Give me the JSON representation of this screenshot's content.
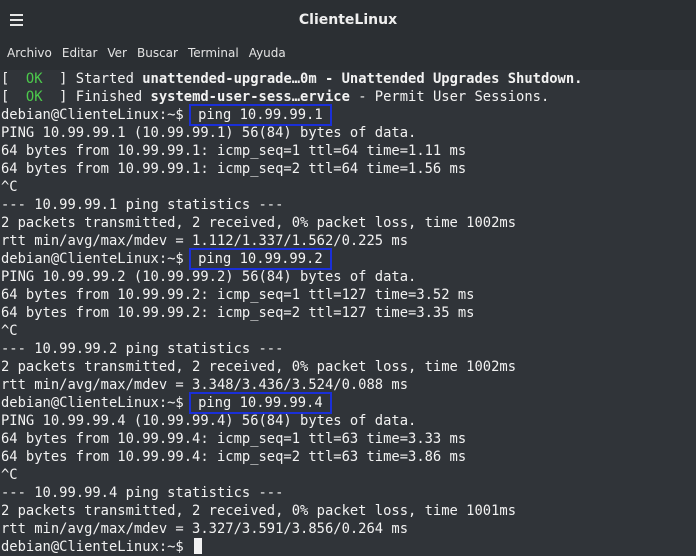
{
  "window": {
    "title": "ClienteLinux"
  },
  "menu": [
    "Archivo",
    "Editar",
    "Ver",
    "Buscar",
    "Terminal",
    "Ayuda"
  ],
  "prompt": "debian@ClienteLinux:~$ ",
  "lines": [
    {
      "type": "status",
      "pre": "[  ",
      "ok": "OK",
      "mid": "  ] Started ",
      "unit": "unattended-upgrade…0m - Unattended Upgrades Shutdown.",
      "rest": ""
    },
    {
      "type": "status",
      "pre": "[  ",
      "ok": "OK",
      "mid": "  ] Finished ",
      "unit": "systemd-user-sess…ervice",
      "rest": " - Permit User Sessions."
    },
    {
      "type": "prompt",
      "command": "ping 10.99.99.1"
    },
    {
      "type": "text",
      "text": "PING 10.99.99.1 (10.99.99.1) 56(84) bytes of data."
    },
    {
      "type": "text",
      "text": "64 bytes from 10.99.99.1: icmp_seq=1 ttl=64 time=1.11 ms"
    },
    {
      "type": "text",
      "text": "64 bytes from 10.99.99.1: icmp_seq=2 ttl=64 time=1.56 ms"
    },
    {
      "type": "text",
      "text": "^C"
    },
    {
      "type": "text",
      "text": "--- 10.99.99.1 ping statistics ---"
    },
    {
      "type": "text",
      "text": "2 packets transmitted, 2 received, 0% packet loss, time 1002ms"
    },
    {
      "type": "text",
      "text": "rtt min/avg/max/mdev = 1.112/1.337/1.562/0.225 ms"
    },
    {
      "type": "prompt",
      "command": "ping 10.99.99.2"
    },
    {
      "type": "text",
      "text": "PING 10.99.99.2 (10.99.99.2) 56(84) bytes of data."
    },
    {
      "type": "text",
      "text": "64 bytes from 10.99.99.2: icmp_seq=1 ttl=127 time=3.52 ms"
    },
    {
      "type": "text",
      "text": "64 bytes from 10.99.99.2: icmp_seq=2 ttl=127 time=3.35 ms"
    },
    {
      "type": "text",
      "text": "^C"
    },
    {
      "type": "text",
      "text": "--- 10.99.99.2 ping statistics ---"
    },
    {
      "type": "text",
      "text": "2 packets transmitted, 2 received, 0% packet loss, time 1002ms"
    },
    {
      "type": "text",
      "text": "rtt min/avg/max/mdev = 3.348/3.436/3.524/0.088 ms"
    },
    {
      "type": "prompt",
      "command": "ping 10.99.99.4"
    },
    {
      "type": "text",
      "text": "PING 10.99.99.4 (10.99.99.4) 56(84) bytes of data."
    },
    {
      "type": "text",
      "text": "64 bytes from 10.99.99.4: icmp_seq=1 ttl=63 time=3.33 ms"
    },
    {
      "type": "text",
      "text": "64 bytes from 10.99.99.4: icmp_seq=2 ttl=63 time=3.86 ms"
    },
    {
      "type": "text",
      "text": "^C"
    },
    {
      "type": "text",
      "text": "--- 10.99.99.4 ping statistics ---"
    },
    {
      "type": "text",
      "text": "2 packets transmitted, 2 received, 0% packet loss, time 1001ms"
    },
    {
      "type": "text",
      "text": "rtt min/avg/max/mdev = 3.327/3.591/3.856/0.264 ms"
    },
    {
      "type": "prompt-active",
      "command": ""
    }
  ],
  "colors": {
    "ok": "#4cc94c",
    "highlight_box": "#1a2fd8",
    "background": "#303439"
  }
}
